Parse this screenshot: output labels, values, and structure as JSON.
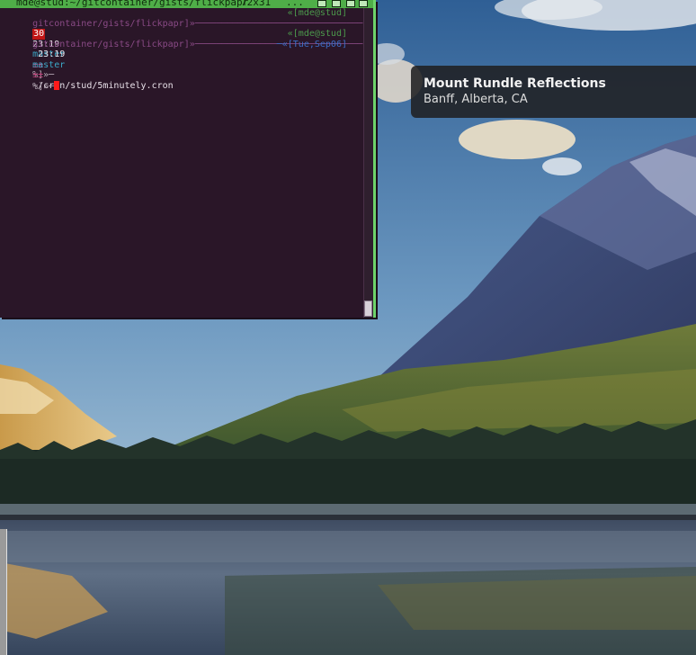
{
  "terminal": {
    "title": "mde@stud:~/gitcontainer/gists/flickpapr",
    "size": "72x31",
    "extra": "...",
    "lines": {
      "l1_path": "gitcontainer/gists/flickpapr]»",
      "l1_dashes": "───────────────────────────────",
      "l1_host": "«[mde@stud]",
      "l2_time": "30",
      "l2_clock": "23:19",
      "l2_branch": "master",
      "l2_flags": "±±",
      "l2_pct": "%]»─",
      "l2_cmd": "~/cron/stud/5minutely.cron",
      "l3_path": "gitcontainer/gists/flickpapr]»",
      "l3_dashes": "───────────────────────────────",
      "l3_host": "«[mde@stud]",
      "l4_clock": "23:19",
      "l4_branch": "master",
      "l4_flags": "±±",
      "l4_pct": "%]»─",
      "l4_date": "─«[Tue,Sep06]"
    }
  },
  "photo_info": {
    "title": "Mount Rundle Reflections",
    "location": "Banff, Alberta, CA"
  },
  "colors": {
    "terminal_bg": "#2a1628",
    "border_accent": "#6dd36a",
    "cursor": "#ff1a1a"
  }
}
